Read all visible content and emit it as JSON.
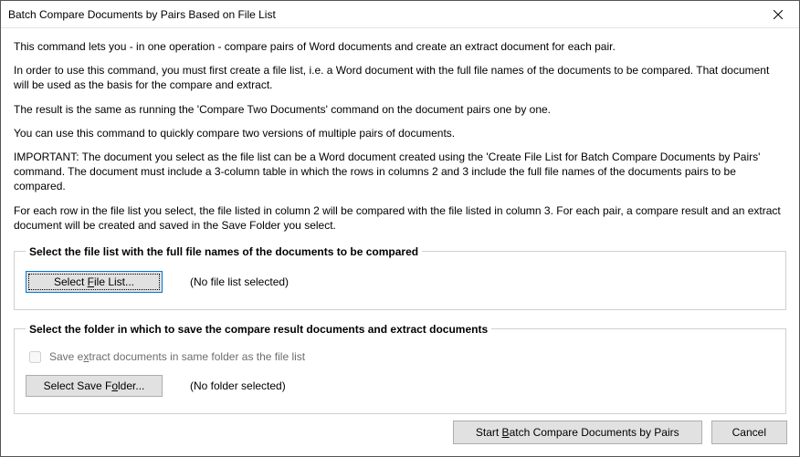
{
  "window": {
    "title": "Batch Compare Documents by Pairs Based on File List"
  },
  "intro": {
    "p1": "This command lets you - in one operation - compare pairs of Word documents and create an extract document for each pair.",
    "p2": "In order to use this command, you must first create a file list, i.e. a Word document with the full file names of the documents to be compared. That document will be used as the basis for the compare and extract.",
    "p3": "The result is the same as running the 'Compare Two Documents' command on the document pairs one by one.",
    "p4": "You can use this command to quickly compare two versions of multiple pairs of documents.",
    "p5": "IMPORTANT: The document you select as the file list can be a Word document created using the 'Create File List for Batch Compare Documents by Pairs' command. The document must include a 3-column table in which the rows in columns 2 and 3 include the full file names of the documents pairs to be compared.",
    "p6": "For each row in the file list you select, the file listed in column 2 will be compared with the file listed in column 3. For each pair, a compare result and an extract document will be created and saved in the Save Folder you select."
  },
  "group1": {
    "legend": "Select the file list with the full file names of the documents to be compared",
    "button_prefix": "Select ",
    "button_key": "F",
    "button_suffix": "ile List...",
    "status": "(No file list selected)"
  },
  "group2": {
    "legend": "Select the folder in which to save the compare result documents and extract documents",
    "checkbox_prefix": "Save e",
    "checkbox_key": "x",
    "checkbox_suffix": "tract documents in same folder as the file list",
    "checkbox_checked": false,
    "checkbox_disabled": true,
    "button_prefix": "Select Save F",
    "button_key": "o",
    "button_suffix": "lder...",
    "status": "(No folder selected)"
  },
  "footer": {
    "start_prefix": "Start ",
    "start_key": "B",
    "start_suffix": "atch Compare Documents by Pairs",
    "cancel": "Cancel"
  }
}
